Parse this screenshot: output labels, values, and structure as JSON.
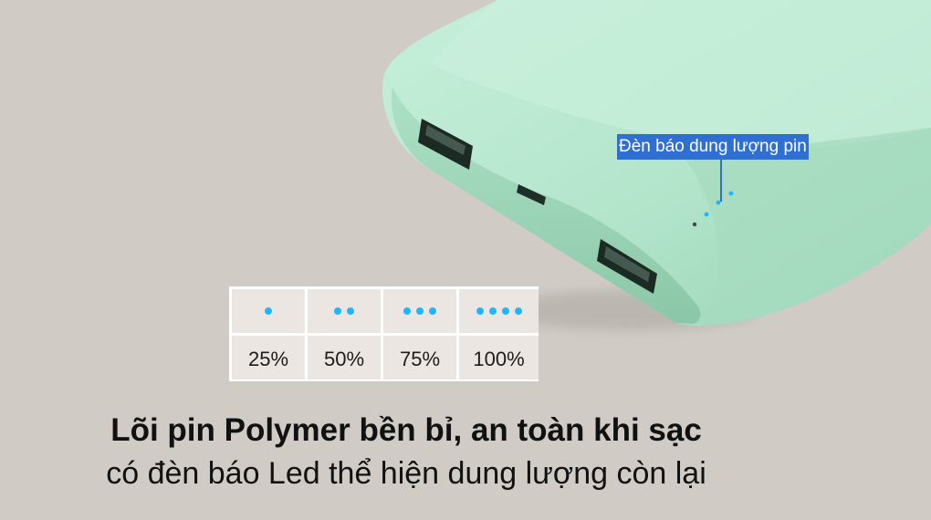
{
  "callout": {
    "text": "Đèn báo dung lượng pin"
  },
  "levels": [
    {
      "dots": 1,
      "label": "25%"
    },
    {
      "dots": 2,
      "label": "50%"
    },
    {
      "dots": 3,
      "label": "75%"
    },
    {
      "dots": 4,
      "label": "100%"
    }
  ],
  "caption": {
    "title": "Lõi pin Polymer bền bỉ, an toàn khi sạc",
    "subtitle": "có đèn báo Led thể hiện dung lượng còn lại"
  },
  "colors": {
    "background": "#d0ccc5",
    "device_body": "#b8e8d0",
    "indicator_dot": "#1fb6ff",
    "callout_fill": "#2f6fd1"
  },
  "icons": {
    "led": "led-indicator-icon",
    "usb_port": "usb-port-icon",
    "micro_usb_port": "micro-usb-port-icon"
  }
}
